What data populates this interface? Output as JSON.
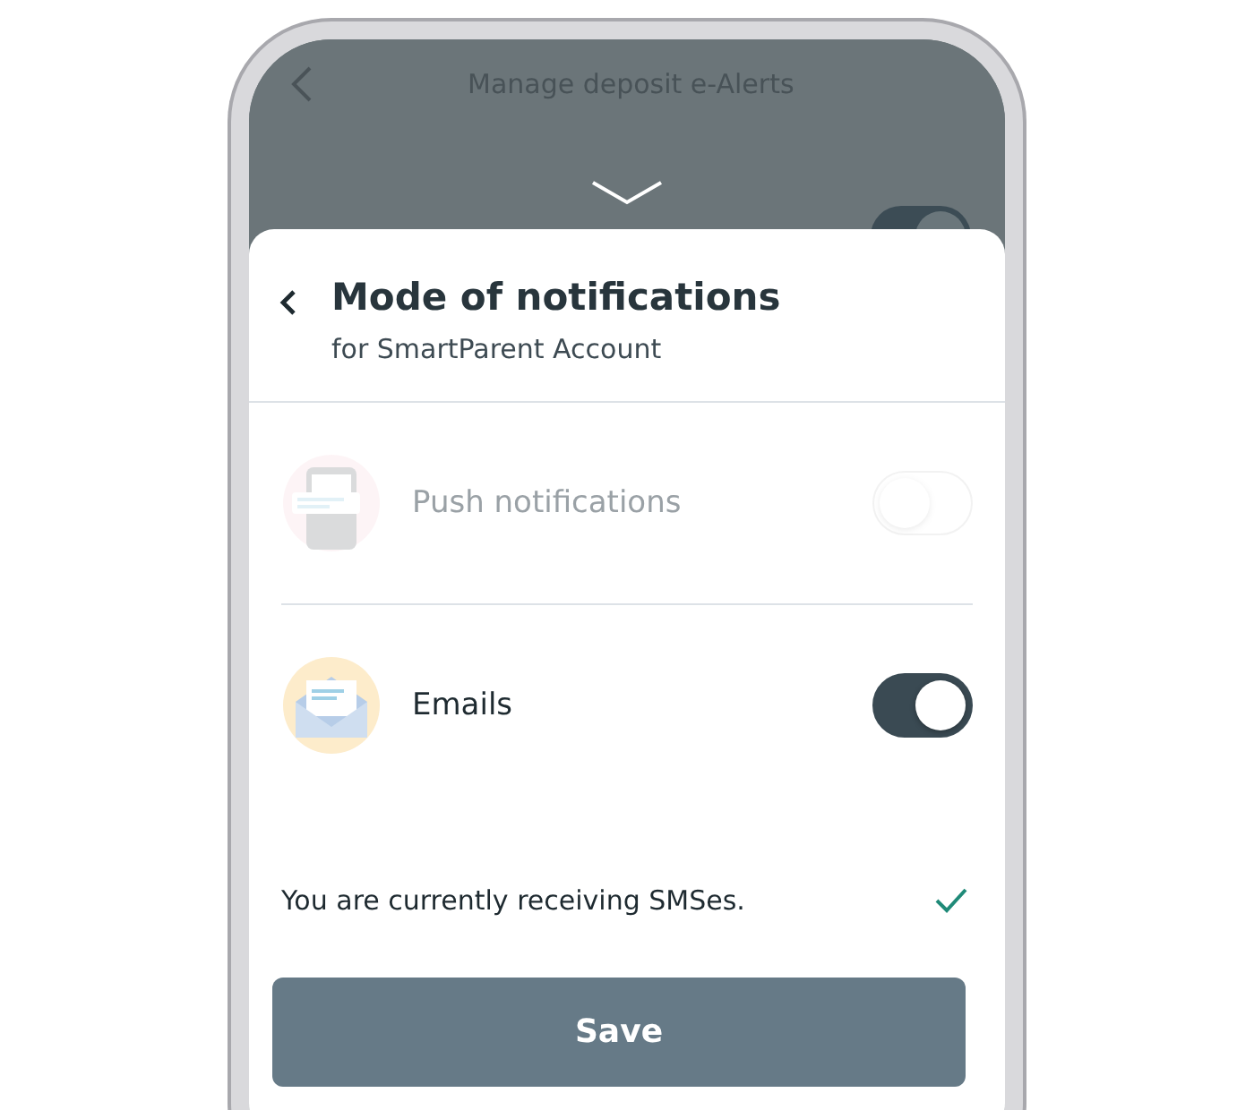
{
  "background_screen": {
    "title": "Manage deposit e-Alerts",
    "toggle_on": true
  },
  "sheet": {
    "title": "Mode of notifications",
    "subtitle": "for SmartParent Account"
  },
  "options": [
    {
      "kind": "push",
      "label": "Push notifications",
      "disabled": true,
      "on": false
    },
    {
      "kind": "email",
      "label": "Emails",
      "disabled": false,
      "on": true
    }
  ],
  "info": {
    "text": "You are currently receiving SMSes.",
    "checked": true
  },
  "save_button": "Save"
}
